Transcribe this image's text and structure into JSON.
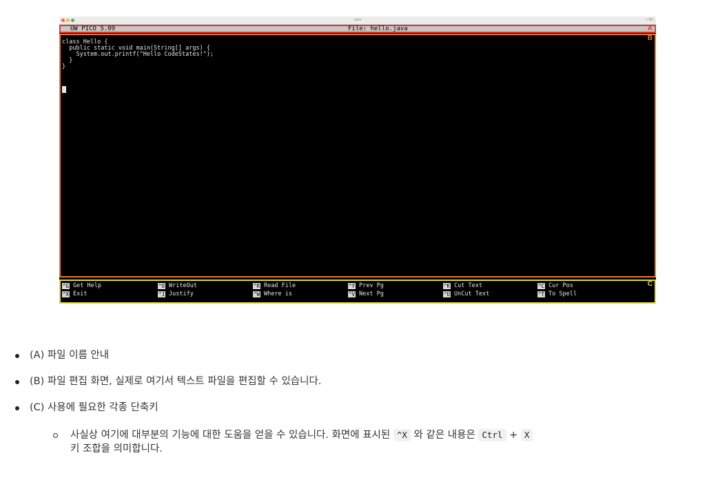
{
  "window": {
    "title": "nano",
    "shortcut": "⌥⌘1"
  },
  "nano": {
    "app_version": "UW PICO 5.09",
    "file_label": "File: hello.java",
    "header_marker": "A",
    "editor_marker": "B",
    "shortcuts_marker": "C",
    "code": "class Hello {\n  public static void main(String[] args) {\n    System.out.printf(\"Hello CodeStates!\");\n  }\n}",
    "shortcuts": [
      {
        "key": "^G",
        "label": "Get Help"
      },
      {
        "key": "^O",
        "label": "WriteOut"
      },
      {
        "key": "^R",
        "label": "Read File"
      },
      {
        "key": "^Y",
        "label": "Prev Pg"
      },
      {
        "key": "^K",
        "label": "Cut Text"
      },
      {
        "key": "^C",
        "label": "Cur Pos"
      },
      {
        "key": "^X",
        "label": "Exit"
      },
      {
        "key": "^J",
        "label": "Justify"
      },
      {
        "key": "^W",
        "label": "Where is"
      },
      {
        "key": "^V",
        "label": "Next Pg"
      },
      {
        "key": "^U",
        "label": "UnCut Text"
      },
      {
        "key": "^T",
        "label": "To Spell"
      }
    ]
  },
  "notes": {
    "a": "(A) 파일 이름 안내",
    "b": "(B) 파일 편집 화면, 실제로 여기서 텍스트 파일을 편집할 수 있습니다.",
    "c": "(C) 사용에 필요한 각종 단축키",
    "sub_text1": "사실상 여기에 대부분의 기능에 대한 도움을 얻을 수 있습니다. 화면에 표시된",
    "sub_code1": "^X",
    "sub_text2": "와 같은 내용은",
    "sub_code2": "Ctrl",
    "sub_plus": "+",
    "sub_code3": "X",
    "sub_text3": "키 조합을 의미합니다."
  }
}
